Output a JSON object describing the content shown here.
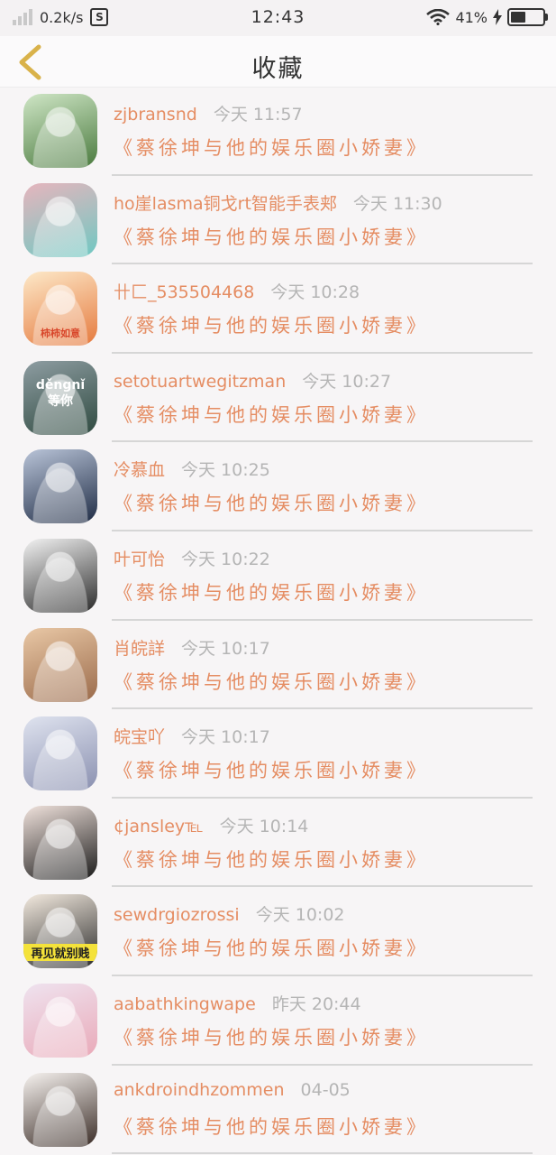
{
  "status_bar": {
    "speed": "0.2k/s",
    "s_badge": "S",
    "time": "12:43",
    "battery": "41%",
    "icons": [
      "signal-icon",
      "wifi-icon",
      "battery-icon",
      "charging-icon"
    ]
  },
  "header": {
    "title": "收藏",
    "back_icon": "chevron-left-icon"
  },
  "colors": {
    "accent": "#e58d63",
    "date": "#b5b5b5",
    "background": "#f7f5f6"
  },
  "items": [
    {
      "name": "zjbransnd",
      "date": "今天 11:57",
      "book": "《蔡徐坤与他的娱乐圈小娇妻》",
      "avatar_colors": [
        "#cfe6c6",
        "#4a7a3e"
      ],
      "avatar_text": ""
    },
    {
      "name": "ho崖lasma铜戈rt智能手表郏",
      "date": "今天 11:30",
      "book": "《蔡徐坤与他的娱乐圈小娇妻》",
      "avatar_colors": [
        "#e6b5bd",
        "#6fc8c2"
      ],
      "avatar_text": ""
    },
    {
      "name": "卄匚_535504468",
      "date": "今天 10:28",
      "book": "《蔡徐坤与他的娱乐圈小娇妻》",
      "avatar_colors": [
        "#fde9c9",
        "#e5793d"
      ],
      "avatar_text": "柿柿如意"
    },
    {
      "name": "setotuartwegitzman",
      "date": "今天 10:27",
      "book": "《蔡徐坤与他的娱乐圈小娇妻》",
      "avatar_colors": [
        "#8e9da2",
        "#2f4a40"
      ],
      "avatar_text": "děngnǐ\n等你"
    },
    {
      "name": "冷慕血",
      "date": "今天 10:25",
      "book": "《蔡徐坤与他的娱乐圈小娇妻》",
      "avatar_colors": [
        "#b9c4d8",
        "#1f2c45"
      ],
      "avatar_text": ""
    },
    {
      "name": "叶可怡",
      "date": "今天 10:22",
      "book": "《蔡徐坤与他的娱乐圈小娇妻》",
      "avatar_colors": [
        "#f2f2f2",
        "#2a2a2a"
      ],
      "avatar_text": ""
    },
    {
      "name": "肖皖詳",
      "date": "今天 10:17",
      "book": "《蔡徐坤与他的娱乐圈小娇妻》",
      "avatar_colors": [
        "#e9c8a6",
        "#9a6a4a"
      ],
      "avatar_text": ""
    },
    {
      "name": "皖宝吖",
      "date": "今天 10:17",
      "book": "《蔡徐坤与他的娱乐圈小娇妻》",
      "avatar_colors": [
        "#dfe3ef",
        "#8a90b0"
      ],
      "avatar_text": ""
    },
    {
      "name": "¢jansley℡",
      "date": "今天 10:14",
      "book": "《蔡徐坤与他的娱乐圈小娇妻》",
      "avatar_colors": [
        "#f0e2dc",
        "#1a1a1a"
      ],
      "avatar_text": ""
    },
    {
      "name": "sewdrgiozrossi",
      "date": "今天 10:02",
      "book": "《蔡徐坤与他的娱乐圈小娇妻》",
      "avatar_colors": [
        "#f3eadf",
        "#2a2a2a"
      ],
      "avatar_text": "再见就别贱"
    },
    {
      "name": "aabathkingwape",
      "date": "昨天 20:44",
      "book": "《蔡徐坤与他的娱乐圈小娇妻》",
      "avatar_colors": [
        "#efe3ef",
        "#e9a9b8"
      ],
      "avatar_text": ""
    },
    {
      "name": "ankdroindhzommen",
      "date": "04-05",
      "book": "《蔡徐坤与他的娱乐圈小娇妻》",
      "avatar_colors": [
        "#f7f3f0",
        "#3a2c26"
      ],
      "avatar_text": ""
    }
  ]
}
